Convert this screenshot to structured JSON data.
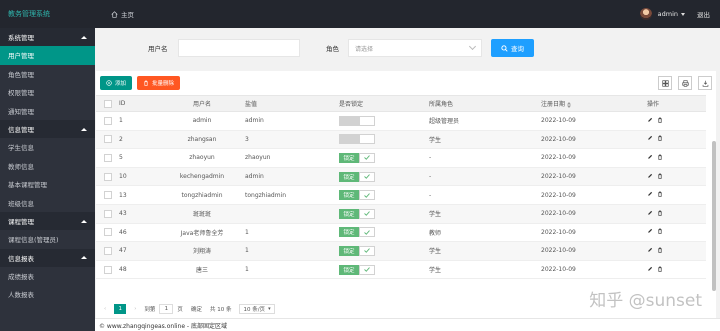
{
  "header": {
    "app_title": "教务管理系统",
    "home_label": "主页",
    "user": "admin",
    "logout": "退出"
  },
  "sidebar": {
    "groups": [
      {
        "label": "系统管理",
        "items": [
          "用户管理",
          "角色管理",
          "权限管理",
          "通知管理"
        ]
      },
      {
        "label": "信息管理",
        "items": [
          "学生信息",
          "教师信息",
          "基本课程管理",
          "班级信息"
        ]
      },
      {
        "label": "课程管理",
        "items": [
          "课程信息(管理员)"
        ]
      },
      {
        "label": "信息报表",
        "items": [
          "成绩报表",
          "人数报表"
        ]
      }
    ],
    "active": "用户管理"
  },
  "search": {
    "username_label": "用户名",
    "username_value": "",
    "role_label": "角色",
    "role_placeholder": "请选择",
    "search_button": "查询"
  },
  "toolbar": {
    "add_label": "添加",
    "bulk_delete_label": "批量删除"
  },
  "table": {
    "headers": [
      "ID",
      "用户名",
      "盐值",
      "是否锁定",
      "所属角色",
      "注册日期",
      "操作"
    ],
    "rows": [
      {
        "id": "1",
        "username": "admin",
        "salt": "admin",
        "locked": "",
        "role": "超级管理员",
        "date": "2022-10-09"
      },
      {
        "id": "2",
        "username": "zhangsan",
        "salt": "3",
        "locked": "",
        "role": "学生",
        "date": "2022-10-09"
      },
      {
        "id": "5",
        "username": "zhaoyun",
        "salt": "zhaoyun",
        "locked": "锁定",
        "role": "-",
        "date": "2022-10-09"
      },
      {
        "id": "10",
        "username": "kechengadmin",
        "salt": "admin",
        "locked": "锁定",
        "role": "-",
        "date": "2022-10-09"
      },
      {
        "id": "13",
        "username": "tongzhiadmin",
        "salt": "tongzhiadmin",
        "locked": "锁定",
        "role": "-",
        "date": "2022-10-09"
      },
      {
        "id": "43",
        "username": "斑斑斑",
        "salt": "",
        "locked": "锁定",
        "role": "学生",
        "date": "2022-10-09"
      },
      {
        "id": "46",
        "username": "Java老师鲁全芳",
        "salt": "1",
        "locked": "锁定",
        "role": "教师",
        "date": "2022-10-09"
      },
      {
        "id": "47",
        "username": "刘翔涛",
        "salt": "1",
        "locked": "锁定",
        "role": "学生",
        "date": "2022-10-09"
      },
      {
        "id": "48",
        "username": "唐三",
        "salt": "1",
        "locked": "锁定",
        "role": "学生",
        "date": "2022-10-09"
      }
    ]
  },
  "pager": {
    "current": "1",
    "goto_label": "到第",
    "goto_value": "1",
    "page_unit": "页",
    "confirm": "确定",
    "total": "共 10 条",
    "per_page": "10 条/页"
  },
  "footer": "© www.zhangqingeas.online - 底部固定区域",
  "watermark": "知乎 @sunset",
  "colors": {
    "accent": "#009688",
    "danger": "#ff5722",
    "primary": "#1e9fff",
    "header": "#23262e",
    "sidebar": "#2e323c"
  }
}
